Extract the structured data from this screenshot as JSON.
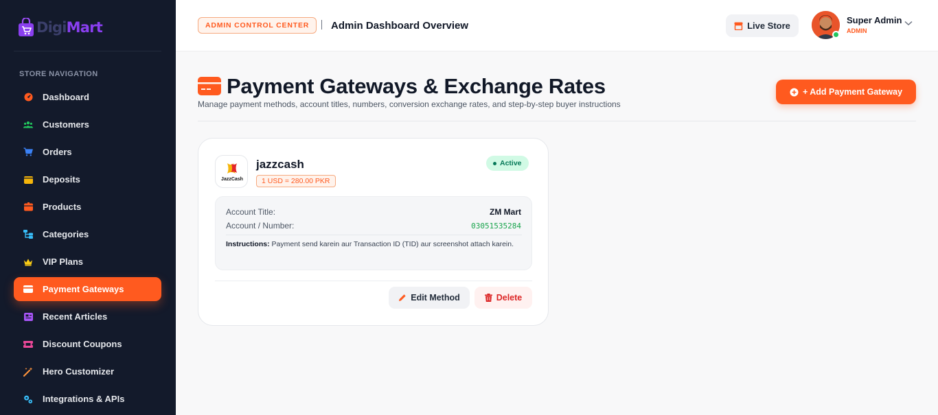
{
  "brand": {
    "name_part1": "Digi",
    "name_part2": "Mart"
  },
  "sidebar": {
    "heading": "STORE NAVIGATION",
    "items": [
      {
        "label": "Dashboard",
        "icon": "gauge-icon",
        "color": "#ff5a1f"
      },
      {
        "label": "Customers",
        "icon": "users-icon",
        "color": "#22c55e"
      },
      {
        "label": "Orders",
        "icon": "cart-icon",
        "color": "#3b82f6"
      },
      {
        "label": "Deposits",
        "icon": "wallet-icon",
        "color": "#f5b50a"
      },
      {
        "label": "Products",
        "icon": "box-icon",
        "color": "#ff5a1f"
      },
      {
        "label": "Categories",
        "icon": "sitemap-icon",
        "color": "#38bdf8"
      },
      {
        "label": "VIP Plans",
        "icon": "crown-icon",
        "color": "#facc15"
      },
      {
        "label": "Payment Gateways",
        "icon": "credit-card-icon",
        "color": "#ffffff",
        "active": true
      },
      {
        "label": "Recent Articles",
        "icon": "newspaper-icon",
        "color": "#a855f7"
      },
      {
        "label": "Discount Coupons",
        "icon": "ticket-icon",
        "color": "#ec4899"
      },
      {
        "label": "Hero Customizer",
        "icon": "magic-wand-icon",
        "color": "#fb923c"
      },
      {
        "label": "Integrations & APIs",
        "icon": "cogs-icon",
        "color": "#38bdf8"
      }
    ]
  },
  "header": {
    "badge": "ADMIN CONTROL CENTER",
    "title": "Admin Dashboard Overview",
    "live_store": "Live Store",
    "user_name": "Super Admin",
    "user_role": "ADMIN"
  },
  "page": {
    "title": "Payment Gateways & Exchange Rates",
    "subtitle": "Manage payment methods, account titles, numbers, conversion exchange rates, and step-by-step buyer instructions",
    "add_button": "+ Add Payment Gateway"
  },
  "gateway": {
    "logo_text": "JazzCash",
    "name": "jazzcash",
    "rate": "1 USD = 280.00 PKR",
    "status": "Active",
    "account_title_label": "Account Title:",
    "account_title": "ZM Mart",
    "account_number_label": "Account / Number:",
    "account_number": "03051535284",
    "instructions_label": "Instructions:",
    "instructions": "Payment send karein aur Transaction ID (TID) aur screenshot attach karein.",
    "edit_label": "Edit Method",
    "delete_label": "Delete"
  },
  "colors": {
    "accent": "#ff5a1f",
    "sidebar_bg": "#131a2b",
    "success": "#22c55e",
    "danger": "#dc2626"
  }
}
